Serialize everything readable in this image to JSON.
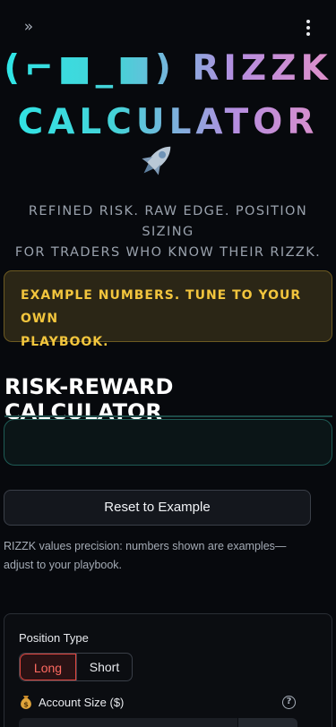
{
  "topbar": {
    "sidebar_toggle_glyph": "»"
  },
  "hero": {
    "title_line1": "(⌐■_■) RIZZK",
    "title_line2": "CALCULATOR",
    "tagline_line1": "REFINED RISK. RAW EDGE. POSITION SIZING",
    "tagline_line2": "FOR TRADERS WHO KNOW THEIR RIZZK."
  },
  "warning": {
    "line1": "EXAMPLE NUMBERS. TUNE TO YOUR OWN",
    "line2": "PLAYBOOK."
  },
  "section": {
    "title": "RISK-REWARD CALCULATOR"
  },
  "actions": {
    "reset_label": "Reset to Example"
  },
  "note": {
    "text": "RIZZK values precision: numbers shown are examples—adjust to your playbook."
  },
  "form": {
    "position_type_label": "Position Type",
    "position_options": [
      "Long",
      "Short"
    ],
    "position_selected": "Long",
    "account_size_label": "Account Size ($)",
    "help_glyph": "?"
  },
  "colors": {
    "accent_teal": "#2ee6e6",
    "accent_pink": "#e08fc8",
    "warning_text": "#f2c53d",
    "selected_red": "#e2463f"
  },
  "icons": {
    "sidebar_toggle": "double-chevron-right-icon",
    "menu": "kebab-menu-icon",
    "rocket": "rocket-icon",
    "account": "money-bag-icon",
    "help": "help-circle-icon"
  }
}
